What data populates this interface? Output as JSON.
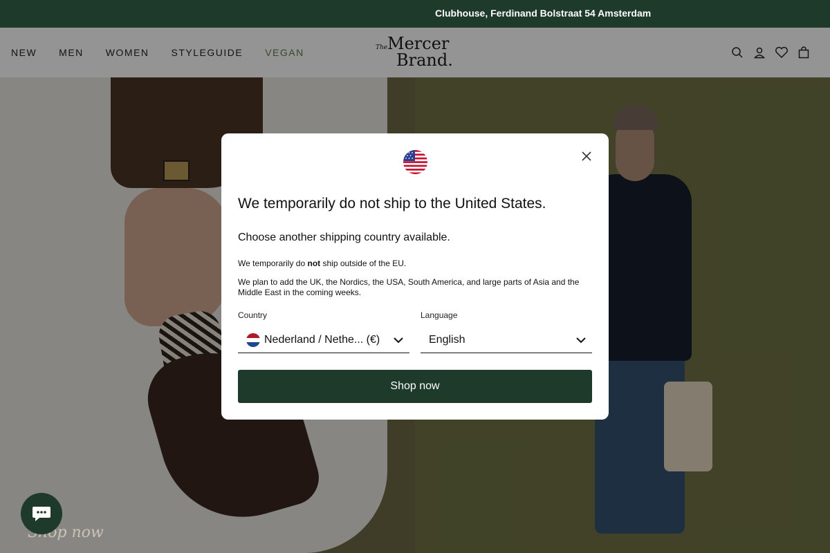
{
  "announcement": "Clubhouse, Ferdinand Bolstraat 54 Amsterdam",
  "nav": {
    "items": [
      {
        "label": "NEW"
      },
      {
        "label": "MEN"
      },
      {
        "label": "WOMEN"
      },
      {
        "label": "STYLEGUIDE"
      },
      {
        "label": "VEGAN"
      }
    ]
  },
  "logo": {
    "the": "The",
    "line1": "Mercer",
    "line2": "Brand."
  },
  "header_icons": [
    "search-icon",
    "account-icon",
    "wishlist-heart-icon",
    "bag-icon"
  ],
  "hero": {
    "cta": "Shop now"
  },
  "modal": {
    "title": "We temporarily do not ship to the United States.",
    "subtitle": "Choose another shipping country available.",
    "notice_prefix": "We temporarily do ",
    "notice_bold": "not",
    "notice_suffix": " ship outside of the EU.",
    "plan": "We plan to add the UK, the Nordics, the USA, South America, and large parts of Asia and the Middle East in the coming weeks.",
    "country_label": "Country",
    "country_value": "Nederland / Nethe... (€)",
    "language_label": "Language",
    "language_value": "English",
    "button": "Shop now"
  },
  "colors": {
    "brand_green": "#1d3a2b",
    "vegan_green": "#5d7d4a"
  }
}
